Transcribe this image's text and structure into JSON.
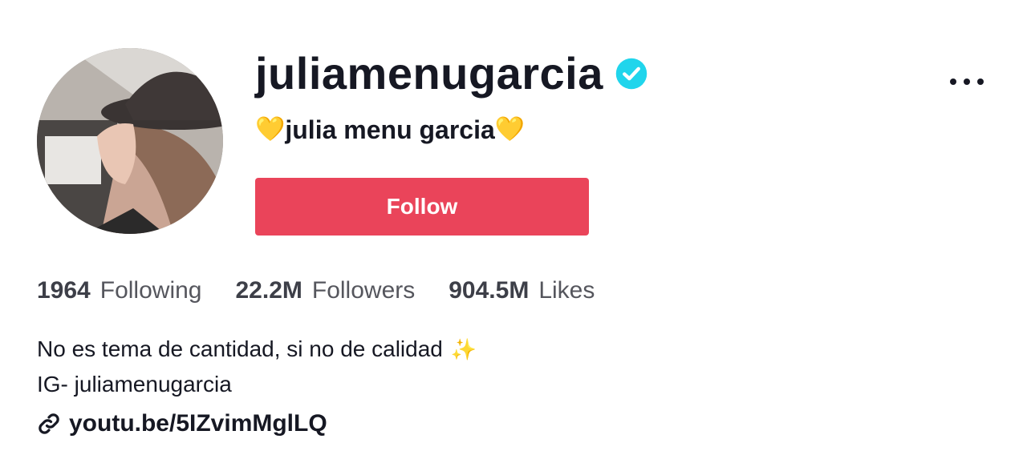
{
  "profile": {
    "username": "juliamenugarcia",
    "verified_icon": "verified-badge-icon",
    "display_name": "julia menu garcia",
    "name_decoration": "💛",
    "follow_label": "Follow",
    "more_icon": "more-options-icon"
  },
  "stats": [
    {
      "value": "1964",
      "label": "Following"
    },
    {
      "value": "22.2M",
      "label": "Followers"
    },
    {
      "value": "904.5M",
      "label": "Likes"
    }
  ],
  "bio": {
    "line1": "No es tema de cantidad, si no de calidad",
    "line1_emoji": "✨",
    "line2": "IG- juliamenugarcia"
  },
  "link": {
    "text": "youtu.be/5IZvimMglLQ",
    "icon": "link-icon"
  },
  "colors": {
    "follow_button": "#ea445a",
    "verified": "#20d5ec",
    "text": "#161823"
  }
}
